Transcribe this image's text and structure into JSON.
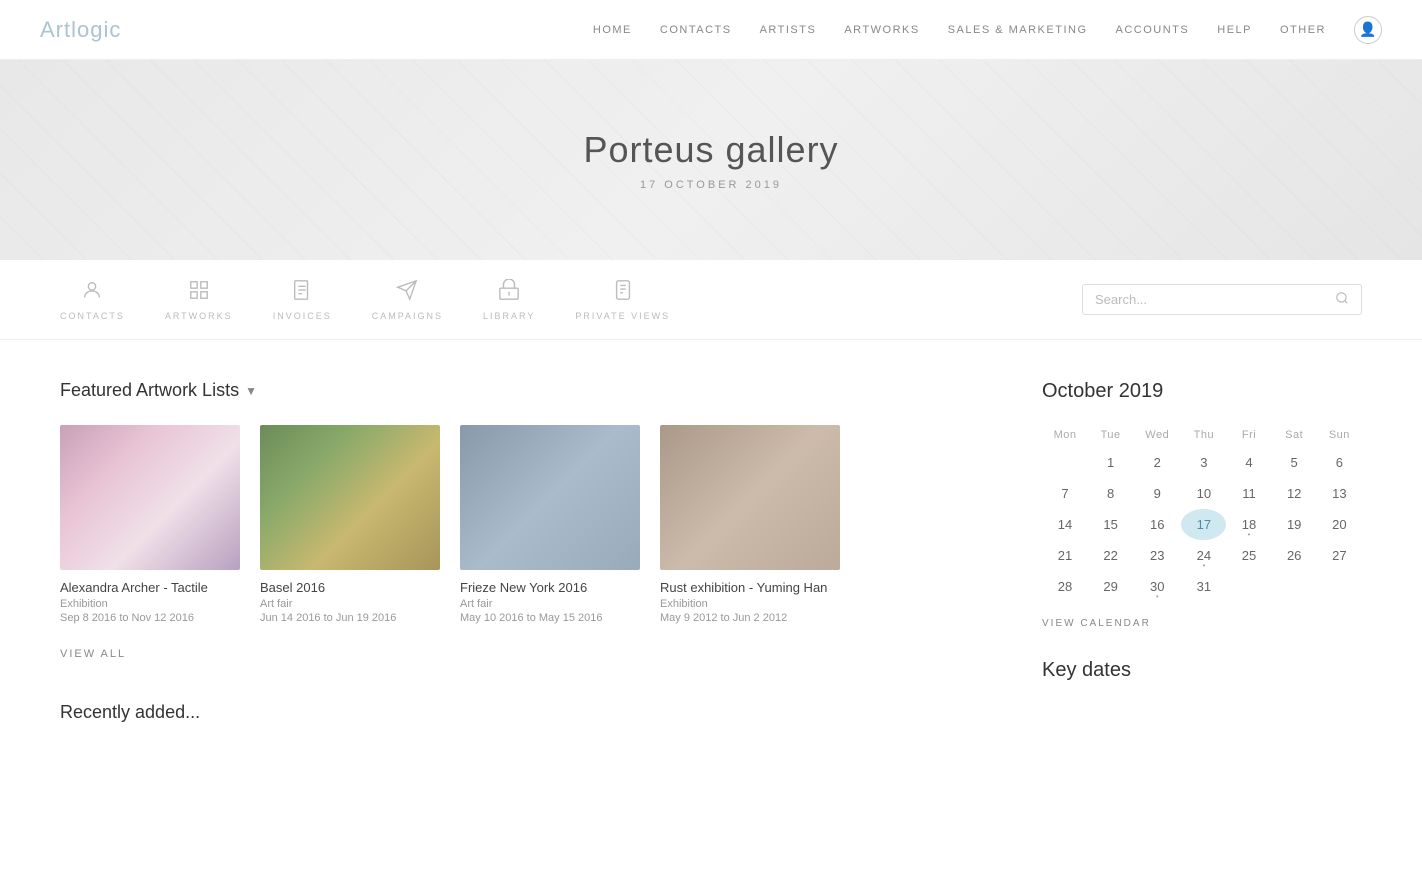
{
  "nav": {
    "logo": "Artlogic",
    "links": [
      "HOME",
      "CONTACTS",
      "ARTISTS",
      "ARTWORKS",
      "SALES & MARKETING",
      "ACCOUNTS",
      "HELP",
      "OTHER"
    ]
  },
  "hero": {
    "title": "Porteus gallery",
    "date": "17 OCTOBER 2019"
  },
  "toolbar": {
    "items": [
      {
        "id": "contacts",
        "label": "CONTACTS",
        "icon": "👤"
      },
      {
        "id": "artworks",
        "label": "ARTWORKS",
        "icon": "⊞"
      },
      {
        "id": "invoices",
        "label": "INVOICES",
        "icon": "📄"
      },
      {
        "id": "campaigns",
        "label": "CAMPAIGNS",
        "icon": "✈"
      },
      {
        "id": "library",
        "label": "LIBRARY",
        "icon": "🏛"
      },
      {
        "id": "privateviews",
        "label": "PRIVATE VIEWS",
        "icon": "📱"
      }
    ],
    "search_placeholder": "Search..."
  },
  "featured": {
    "section_title": "Featured Artwork Lists",
    "view_all_label": "VIEW ALL",
    "artworks": [
      {
        "name": "Alexandra Archer - Tactile",
        "type": "Exhibition",
        "dates": "Sep 8 2016 to Nov 12 2016",
        "thumb_class": "thumb-1"
      },
      {
        "name": "Basel 2016",
        "type": "Art fair",
        "dates": "Jun 14 2016 to Jun 19 2016",
        "thumb_class": "thumb-2"
      },
      {
        "name": "Frieze New York 2016",
        "type": "Art fair",
        "dates": "May 10 2016 to May 15 2016",
        "thumb_class": "thumb-3"
      },
      {
        "name": "Rust exhibition - Yuming Han",
        "type": "Exhibition",
        "dates": "May 9 2012 to Jun 2 2012",
        "thumb_class": "thumb-4"
      }
    ]
  },
  "calendar": {
    "title": "October 2019",
    "days_header": [
      "Mon",
      "Tue",
      "Wed",
      "Thu",
      "Fri",
      "Sat",
      "Sun"
    ],
    "weeks": [
      [
        "",
        "1",
        "2",
        "3",
        "4",
        "5",
        "6"
      ],
      [
        "7",
        "8",
        "9",
        "10",
        "11",
        "12",
        "13"
      ],
      [
        "14",
        "15",
        "16",
        "17",
        "18",
        "19",
        "20"
      ],
      [
        "21",
        "22",
        "23",
        "24",
        "25",
        "26",
        "27"
      ],
      [
        "28",
        "29",
        "30",
        "31",
        "",
        "",
        ""
      ]
    ],
    "today": "17",
    "has_dot": [
      "18",
      "24",
      "30"
    ],
    "view_calendar_label": "VIEW CALENDAR"
  },
  "key_dates": {
    "title": "Key dates"
  }
}
